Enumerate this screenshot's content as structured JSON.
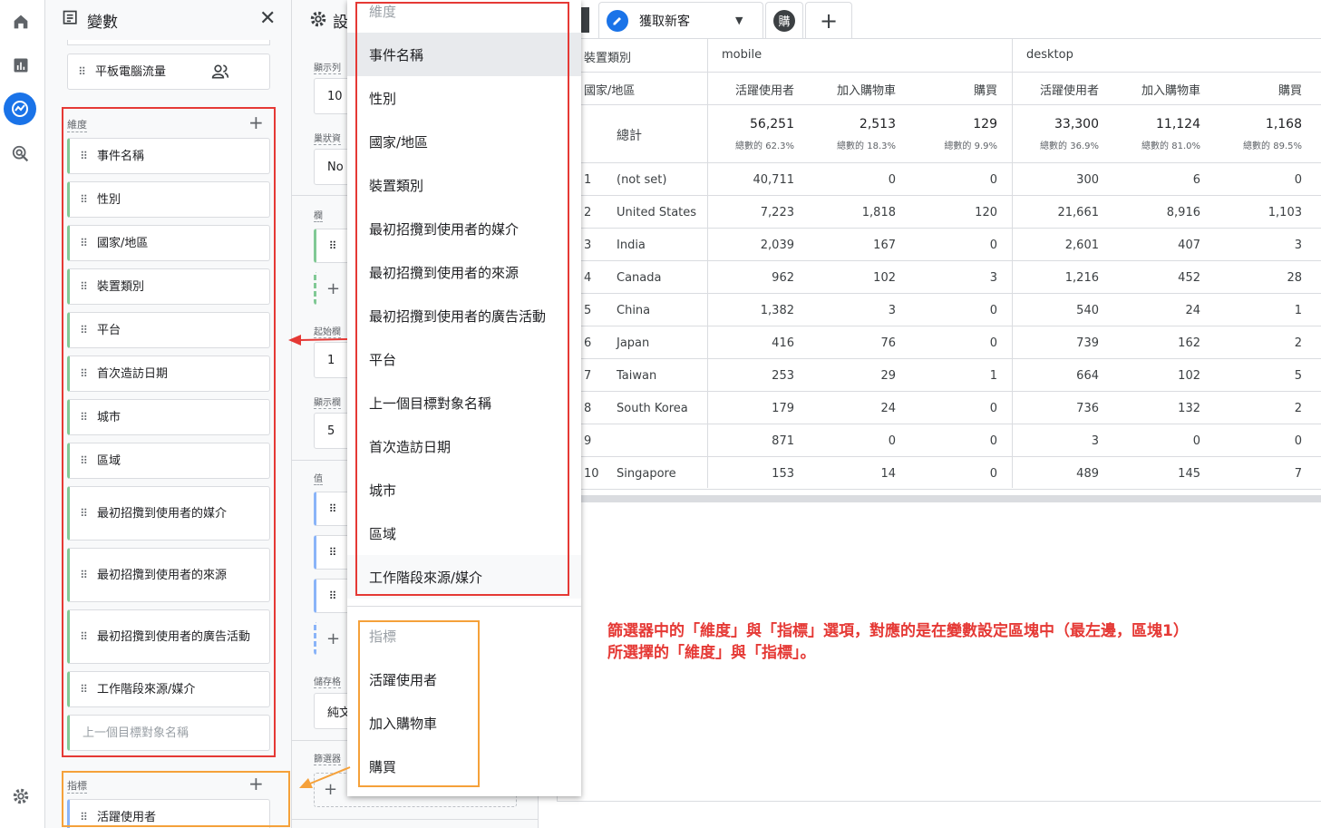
{
  "rail": {
    "icons": [
      "home-icon",
      "bar-chart-icon",
      "explore-icon",
      "target-icon",
      "gear-icon"
    ]
  },
  "variables_panel": {
    "title": "變數",
    "top_card": "平板電腦流量",
    "dimensions_label": "維度",
    "dimensions": [
      "事件名稱",
      "性別",
      "國家/地區",
      "裝置類別",
      "平台",
      "首次造訪日期",
      "城市",
      "區域",
      "最初招攬到使用者的媒介",
      "最初招攬到使用者的來源",
      "最初招攬到使用者的廣告活動",
      "工作階段來源/媒介"
    ],
    "dimension_placeholder": "上一個目標對象名稱",
    "metrics_label": "指標",
    "metrics": [
      "活躍使用者"
    ]
  },
  "settings_panel": {
    "title": "設",
    "labels": [
      "顯示列",
      "巢狀資",
      "欄",
      "起始欄",
      "顯示欄",
      "值",
      "儲存格",
      "篩選器"
    ],
    "values": [
      "10",
      "No",
      "1",
      "5",
      "純文"
    ]
  },
  "tabs": {
    "active_tab": "獲取新客",
    "other_tab": "購"
  },
  "table": {
    "row_dim_header": "裝置類別",
    "col_dim_header": "國家/地區",
    "groups": [
      "mobile",
      "desktop"
    ],
    "metric_headers": [
      "活躍使用者",
      "加入購物車",
      "購買",
      "活躍使用者",
      "加入購物車",
      "購買"
    ],
    "total_label": "總計",
    "totals": [
      "56,251",
      "2,513",
      "129",
      "33,300",
      "11,124",
      "1,168"
    ],
    "total_pcts": [
      "總數的 62.3%",
      "總數的 18.3%",
      "總數的 9.9%",
      "總數的 36.9%",
      "總數的 81.0%",
      "總數的 89.5%"
    ],
    "rows": [
      {
        "n": "1",
        "name": "(not set)",
        "v": [
          "40,711",
          "0",
          "0",
          "300",
          "6",
          "0"
        ]
      },
      {
        "n": "2",
        "name": "United States",
        "v": [
          "7,223",
          "1,818",
          "120",
          "21,661",
          "8,916",
          "1,103"
        ]
      },
      {
        "n": "3",
        "name": "India",
        "v": [
          "2,039",
          "167",
          "0",
          "2,601",
          "407",
          "3"
        ]
      },
      {
        "n": "4",
        "name": "Canada",
        "v": [
          "962",
          "102",
          "3",
          "1,216",
          "452",
          "28"
        ]
      },
      {
        "n": "5",
        "name": "China",
        "v": [
          "1,382",
          "3",
          "0",
          "540",
          "24",
          "1"
        ]
      },
      {
        "n": "6",
        "name": "Japan",
        "v": [
          "416",
          "76",
          "0",
          "739",
          "162",
          "2"
        ]
      },
      {
        "n": "7",
        "name": "Taiwan",
        "v": [
          "253",
          "29",
          "1",
          "664",
          "102",
          "5"
        ]
      },
      {
        "n": "8",
        "name": "South Korea",
        "v": [
          "179",
          "24",
          "0",
          "736",
          "132",
          "2"
        ]
      },
      {
        "n": "9",
        "name": "",
        "v": [
          "871",
          "0",
          "0",
          "3",
          "0",
          "0"
        ]
      },
      {
        "n": "10",
        "name": "Singapore",
        "v": [
          "153",
          "14",
          "0",
          "489",
          "145",
          "7"
        ]
      }
    ]
  },
  "dropdown": {
    "dim_header": "維度",
    "dim_items": [
      "事件名稱",
      "性別",
      "國家/地區",
      "裝置類別",
      "最初招攬到使用者的媒介",
      "最初招攬到使用者的來源",
      "最初招攬到使用者的廣告活動",
      "平台",
      "上一個目標對象名稱",
      "首次造訪日期",
      "城市",
      "區域",
      "工作階段來源/媒介"
    ],
    "metric_header": "指標",
    "metric_items": [
      "活躍使用者",
      "加入購物車",
      "購買"
    ]
  },
  "annotation": {
    "line1": "篩選器中的「維度」與「指標」選項，對應的是在變數設定區塊中（最左邊，區塊1）",
    "line2": "所選擇的「維度」與「指標」。"
  },
  "colors": {
    "red_highlight": "#e53935",
    "orange_highlight": "#f5a13a",
    "accent_blue": "#1a73e8",
    "dimension_green": "#81c995",
    "metric_blue": "#8ab4f8"
  }
}
